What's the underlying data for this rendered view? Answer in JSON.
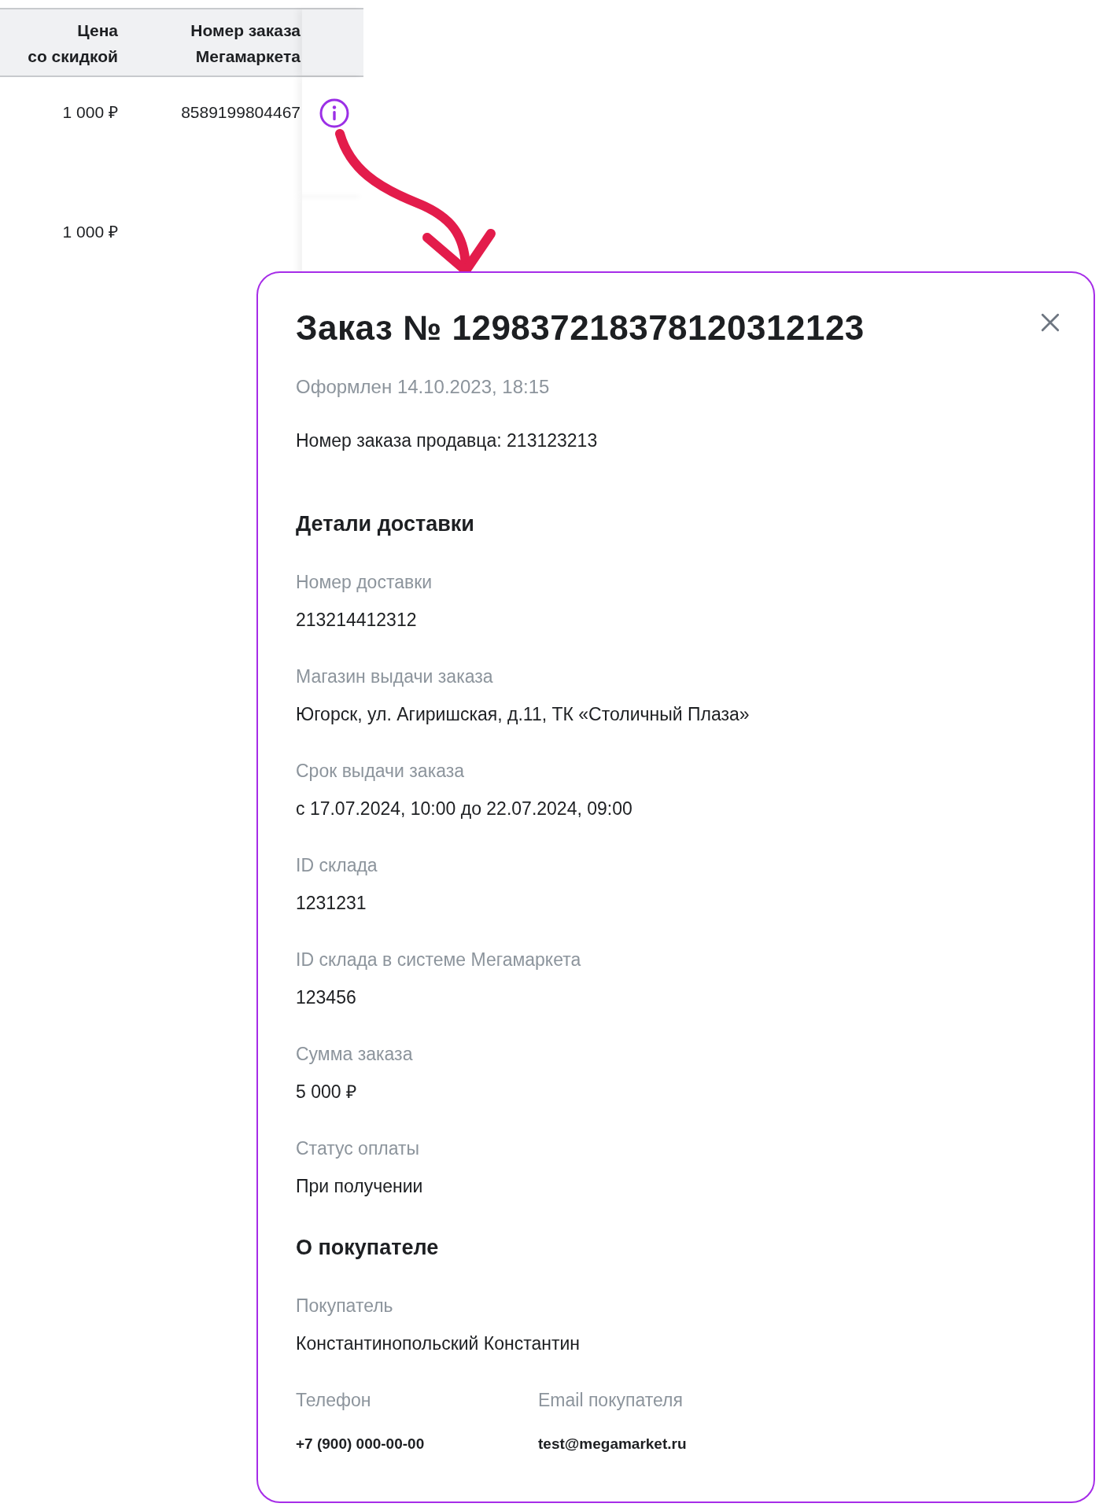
{
  "table": {
    "columns": [
      "Цена\nсо скидкой",
      "Номер заказа\nМегамаркета"
    ],
    "rows": [
      {
        "price": "1 000 ₽",
        "order_number": "8589199804467",
        "info": true
      },
      {
        "price": "1 000 ₽",
        "info": false
      }
    ]
  },
  "popover": {
    "title": "Заказ № 129837218378120312123",
    "created": "Оформлен 14.10.2023, 18:15",
    "seller_order": "Номер заказа продавца: 213123213",
    "sections": [
      {
        "heading": "Детали доставки",
        "fields": [
          {
            "kind": "full",
            "label": "Номер доставки",
            "value": "213214412312"
          },
          {
            "kind": "full",
            "label": "Магазин выдачи заказа",
            "value": "Югорск, ул. Агиришская, д.11, ТК «Столичный Плаза»"
          },
          {
            "kind": "full",
            "label": "Срок выдачи заказа",
            "value": "с 17.07.2024, 10:00 до 22.07.2024, 09:00"
          },
          {
            "kind": "full",
            "label": "ID склада",
            "value": "1231231"
          },
          {
            "kind": "full",
            "label": "ID склада в системе Мегамаркета",
            "value": "123456"
          },
          {
            "kind": "full",
            "label": "Сумма заказа",
            "value": "5 000 ₽"
          },
          {
            "kind": "full",
            "label": "Статус оплаты",
            "value": "При получении"
          }
        ]
      },
      {
        "heading": "О покупателе",
        "fields": [
          {
            "kind": "full",
            "label": "Покупатель",
            "value": "Константинопольский Константин"
          },
          {
            "kind": "half",
            "label": "Телефон",
            "value": "+7 (900) 000-00-00"
          },
          {
            "kind": "half",
            "label": "Email покупателя",
            "value": "test@megamarket.ru"
          }
        ]
      }
    ]
  }
}
